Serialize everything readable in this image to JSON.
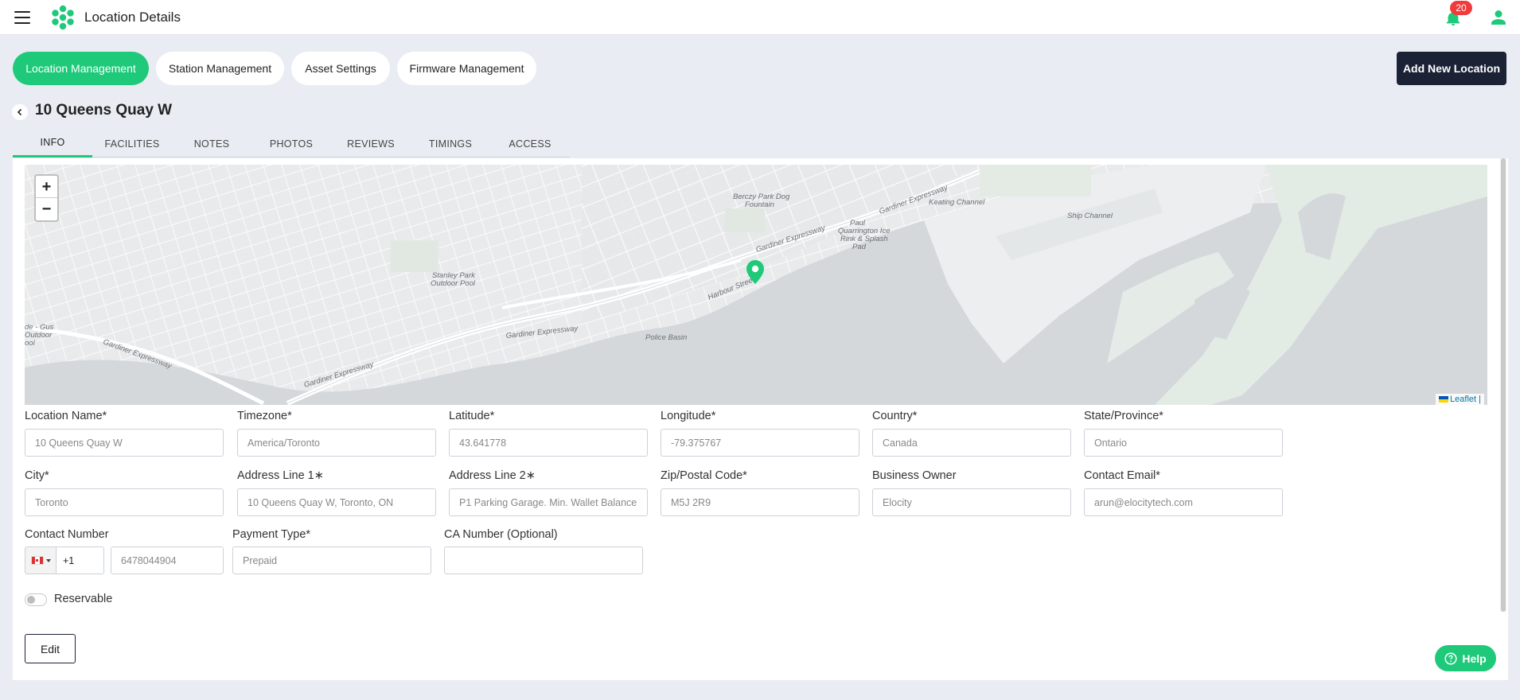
{
  "header": {
    "app_title": "Location Details",
    "notification_count": "20"
  },
  "module_tabs": [
    {
      "label": "Location Management",
      "active": true
    },
    {
      "label": "Station Management",
      "active": false
    },
    {
      "label": "Asset Settings",
      "active": false
    },
    {
      "label": "Firmware Management",
      "active": false
    }
  ],
  "actions": {
    "add_location_label": "Add New Location"
  },
  "location": {
    "title": "10 Queens Quay W"
  },
  "subtabs": [
    "INFO",
    "FACILITIES",
    "NOTES",
    "PHOTOS",
    "REVIEWS",
    "TIMINGS",
    "ACCESS"
  ],
  "active_subtab": "INFO",
  "map": {
    "zoom_in": "+",
    "zoom_out": "−",
    "attribution": "Leaflet |",
    "place_labels": {
      "berczy": "Berczy Park Dog",
      "berczy2": "Fountain",
      "keating": "Keating Channel",
      "ship": "Ship Channel",
      "paul1": "Paul",
      "paul2": "Quarrington Ice",
      "paul3": "Rink & Splash",
      "paul4": "Pad",
      "stanley1": "Stanley Park",
      "stanley2": "Outdoor Pool",
      "gardiner1": "Gardiner Expressway",
      "gardiner2": "Gardiner Expressway",
      "gardiner3": "Gardiner Expressway",
      "gardiner4": "Gardiner Expressway",
      "gardiner5": "Gardiner Expressway",
      "harbour": "Harbour Street",
      "police": "Police Basin",
      "gus1": "de - Gus",
      "gus2": "Outdoor",
      "gus3": "ool"
    }
  },
  "form": {
    "location_name": {
      "label": "Location Name*",
      "value": "10 Queens Quay W"
    },
    "timezone": {
      "label": "Timezone*",
      "value": "America/Toronto"
    },
    "latitude": {
      "label": "Latitude*",
      "value": "43.641778"
    },
    "longitude": {
      "label": "Longitude*",
      "value": "-79.375767"
    },
    "country": {
      "label": "Country*",
      "value": "Canada"
    },
    "state": {
      "label": "State/Province*",
      "value": "Ontario"
    },
    "city": {
      "label": "City*",
      "value": "Toronto"
    },
    "address1": {
      "label": "Address Line 1∗",
      "value": "10 Queens Quay W, Toronto, ON"
    },
    "address2": {
      "label": "Address Line 2∗",
      "value": "P1 Parking Garage. Min. Wallet Balance"
    },
    "zip": {
      "label": "Zip/Postal Code*",
      "value": "M5J 2R9"
    },
    "business_owner": {
      "label": "Business Owner",
      "value": "Elocity"
    },
    "contact_email": {
      "label": "Contact Email*",
      "value": "arun@elocitytech.com"
    },
    "contact_number": {
      "label": "Contact Number",
      "dial_code": "+1",
      "value": "6478044904"
    },
    "payment_type": {
      "label": "Payment Type*",
      "value": "Prepaid"
    },
    "ca_number": {
      "label": "CA Number (Optional)",
      "value": ""
    },
    "reservable": {
      "label": "Reservable",
      "on": false
    }
  },
  "buttons": {
    "edit": "Edit",
    "help": "Help"
  },
  "colors": {
    "accent": "#1fc97a",
    "dark_button": "#1b2236",
    "badge": "#ef3b3b"
  }
}
